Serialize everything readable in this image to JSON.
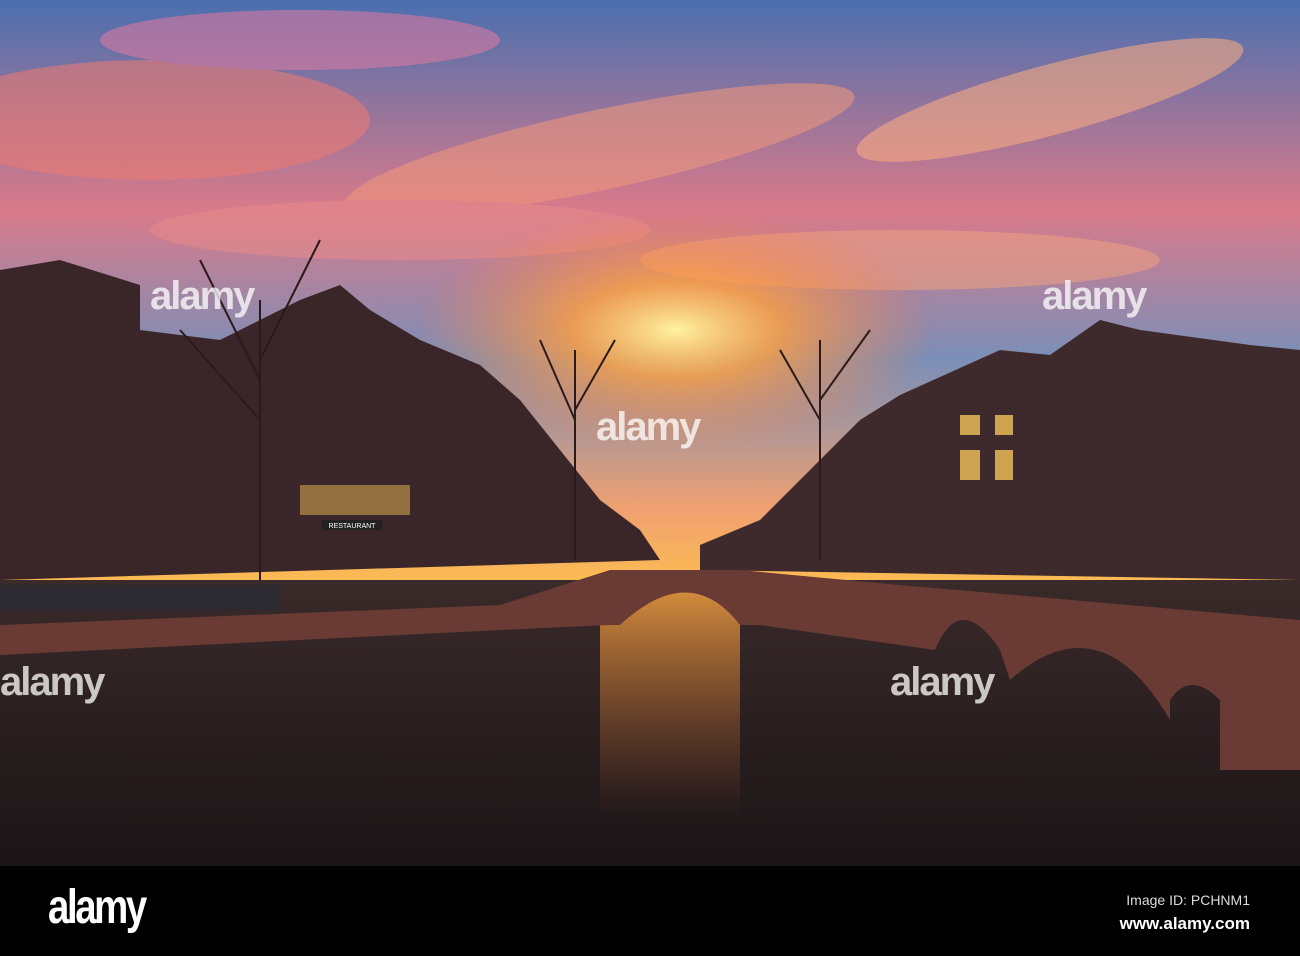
{
  "watermark": {
    "brand": "alamy"
  },
  "signs": {
    "restaurant": "RESTAURANT"
  },
  "footer": {
    "logo": "alamy",
    "image_id": "Image ID: PCHNM1",
    "site": "www.alamy.com"
  }
}
